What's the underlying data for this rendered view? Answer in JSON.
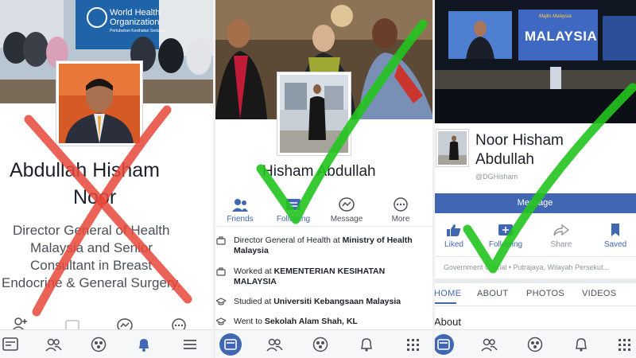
{
  "left_panel": {
    "cover_sign_line1": "World Health",
    "cover_sign_line2": "Organization",
    "cover_sign_line3": "Pertubuhan Kesihatan Sedunia",
    "name_line1": "Abdullah Hisham",
    "name_line2": "Noor",
    "bio_line1": "Director General of Health",
    "bio_line2": "Malaysia and Senior",
    "bio_line3": "Consultant in Breast",
    "bio_line4": "Endocrine & General Surgery.",
    "verdict": "fake",
    "cross_color": "#e8473a"
  },
  "middle_panel": {
    "name": "Hisham Abdullah",
    "actions": [
      {
        "label": "Friends",
        "icon": "friends-icon"
      },
      {
        "label": "Following",
        "icon": "following-icon"
      },
      {
        "label": "Message",
        "icon": "messenger-icon"
      },
      {
        "label": "More",
        "icon": "more-icon"
      }
    ],
    "info": [
      {
        "prefix": "Director General of Health at ",
        "bold": "Ministry of Health Malaysia",
        "icon": "briefcase-icon"
      },
      {
        "prefix": "Worked at ",
        "bold": "KEMENTERIAN KESIHATAN MALAYSIA",
        "icon": "briefcase-icon"
      },
      {
        "prefix": "Studied at ",
        "bold": "Universiti Kebangsaan Malaysia",
        "icon": "graduation-cap-icon"
      },
      {
        "prefix": "Went to ",
        "bold": "Sekolah Alam Shah, KL",
        "icon": "graduation-cap-icon"
      }
    ],
    "verdict": "genuine",
    "check_color": "#22c41e"
  },
  "right_panel": {
    "banner_small": "Majlis Malaysia",
    "banner_text": "MALAYSIA",
    "name_line1": "Noor Hisham",
    "name_line2": "Abdullah",
    "handle": "@DGHisham",
    "message_button": "Message",
    "actions": [
      {
        "label": "Liked",
        "icon": "thumbs-up-icon",
        "active": true
      },
      {
        "label": "Following",
        "icon": "following-icon",
        "active": true
      },
      {
        "label": "Share",
        "icon": "share-icon",
        "active": false
      },
      {
        "label": "Saved",
        "icon": "bookmark-icon",
        "active": true
      }
    ],
    "category_line": "Government Official • Putrajaya, Wilayah Persekut...",
    "tabs": [
      "HOME",
      "ABOUT",
      "PHOTOS",
      "VIDEOS"
    ],
    "section_title": "About",
    "verdict": "genuine",
    "check_color": "#22c41e",
    "brand_color": "#4267b2"
  }
}
